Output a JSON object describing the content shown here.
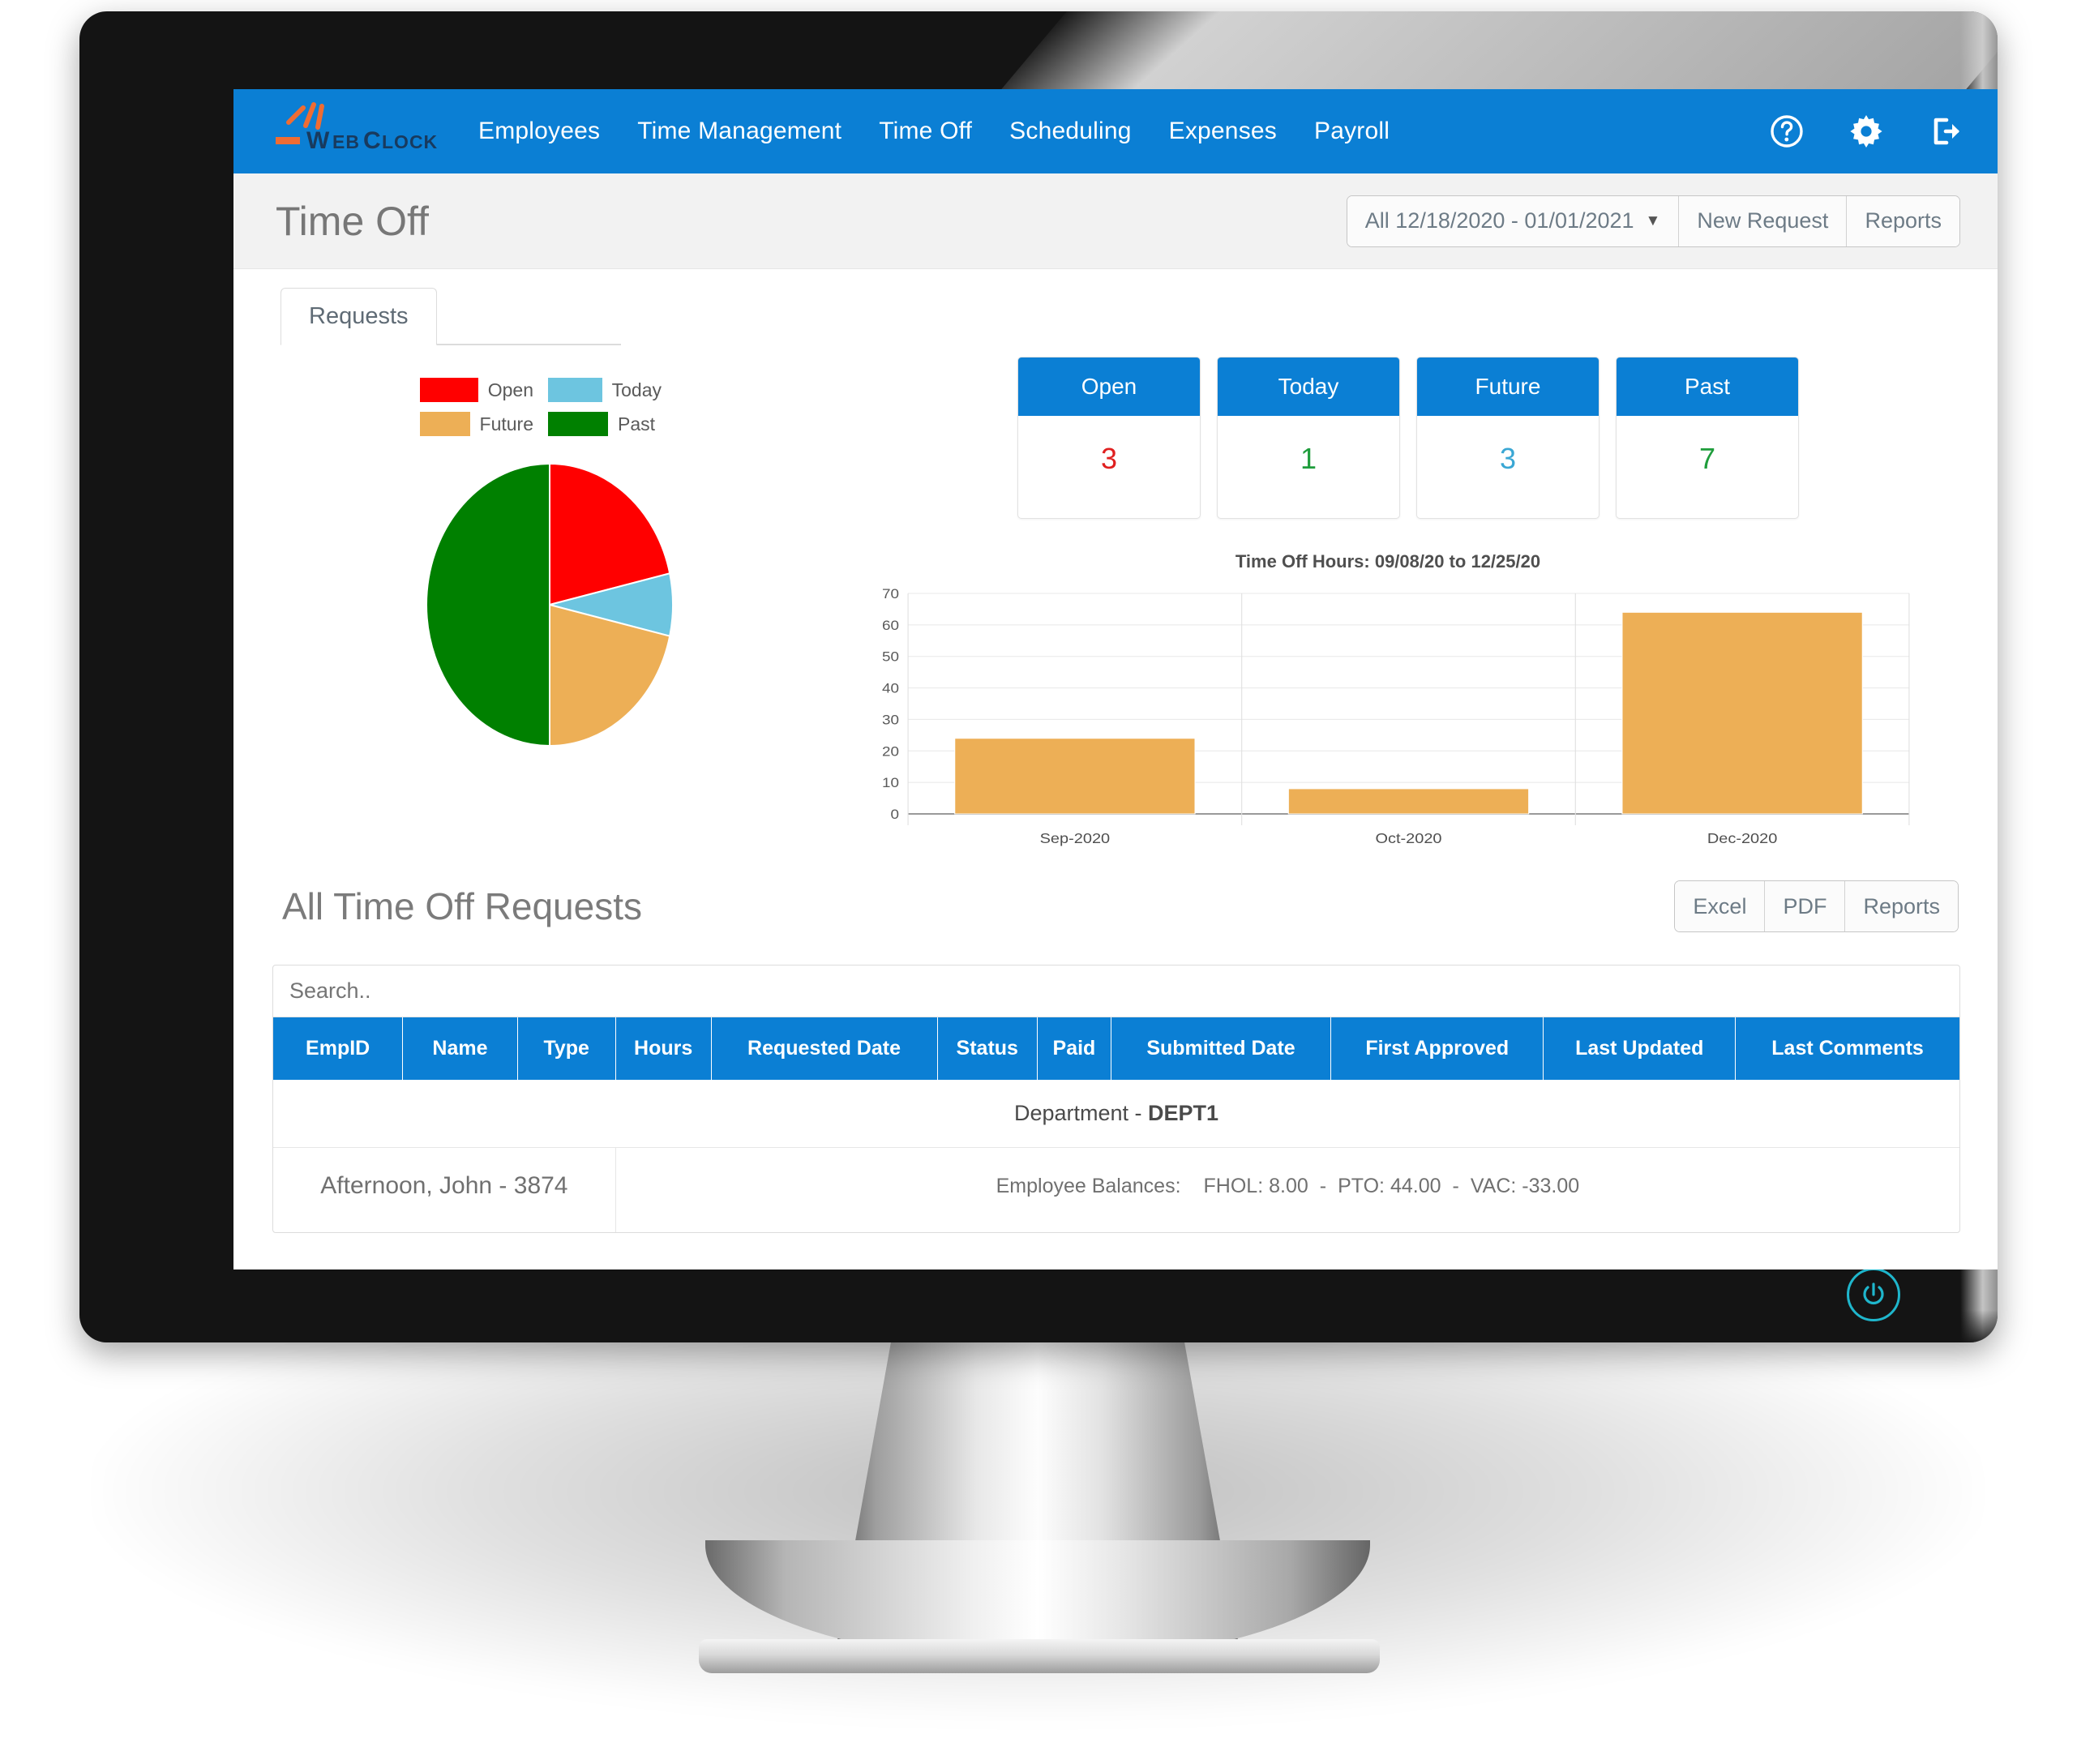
{
  "brand": {
    "name": "WebClock",
    "accent": "#0b7fd4",
    "logo_accent": "#ef6c33",
    "logo_text_color": "#183a5e"
  },
  "topnav": {
    "links": [
      {
        "label": "Employees",
        "name": "nav-employees"
      },
      {
        "label": "Time Management",
        "name": "nav-time-management"
      },
      {
        "label": "Time Off",
        "name": "nav-time-off"
      },
      {
        "label": "Scheduling",
        "name": "nav-scheduling"
      },
      {
        "label": "Expenses",
        "name": "nav-expenses"
      },
      {
        "label": "Payroll",
        "name": "nav-payroll"
      }
    ],
    "icons": [
      {
        "name": "help-icon",
        "label": "Help"
      },
      {
        "name": "gear-icon",
        "label": "Settings"
      },
      {
        "name": "logout-icon",
        "label": "Log Out"
      }
    ]
  },
  "page": {
    "title": "Time Off",
    "date_range": "All 12/18/2020 - 01/01/2021",
    "new_request_label": "New Request",
    "reports_label": "Reports"
  },
  "tabs": [
    {
      "label": "Requests",
      "active": true
    }
  ],
  "stat_cards": [
    {
      "label": "Open",
      "value": "3",
      "color": "#e02020"
    },
    {
      "label": "Today",
      "value": "1",
      "color": "#1f9d3c"
    },
    {
      "label": "Future",
      "value": "3",
      "color": "#3aa7d4"
    },
    {
      "label": "Past",
      "value": "7",
      "color": "#1f9d3c"
    }
  ],
  "chart_data": [
    {
      "type": "pie",
      "title": "",
      "legend_position": "top",
      "categories": [
        "Open",
        "Today",
        "Future",
        "Past"
      ],
      "values": [
        3,
        1,
        3,
        7
      ],
      "percentages": [
        21.4,
        7.1,
        21.4,
        50.0
      ],
      "colors": [
        "#ff0000",
        "#6dc5e0",
        "#edaf56",
        "#008000"
      ],
      "legend": [
        {
          "label": "Open",
          "color": "#ff0000"
        },
        {
          "label": "Today",
          "color": "#6dc5e0"
        },
        {
          "label": "Future",
          "color": "#edaf56"
        },
        {
          "label": "Past",
          "color": "#008000"
        }
      ]
    },
    {
      "type": "bar",
      "title": "Time Off Hours: 09/08/20 to 12/25/20",
      "categories": [
        "Sep-2020",
        "Oct-2020",
        "Dec-2020"
      ],
      "values": [
        24,
        8,
        64
      ],
      "series": [
        {
          "name": "Time Off Hours",
          "values": [
            24,
            8,
            64
          ],
          "color": "#edaf56"
        }
      ],
      "xlabel": "",
      "ylabel": "",
      "ylim": [
        0,
        70
      ],
      "yticks": [
        0,
        10,
        20,
        30,
        40,
        50,
        60,
        70
      ],
      "grid": true,
      "legend_position": "none"
    }
  ],
  "requests_section": {
    "title": "All Time Off Requests",
    "export_buttons": [
      {
        "label": "Excel",
        "name": "excel-button"
      },
      {
        "label": "PDF",
        "name": "pdf-button"
      },
      {
        "label": "Reports",
        "name": "reports-button"
      }
    ],
    "search_placeholder": "Search..",
    "search_value": "",
    "columns": [
      "EmpID",
      "Name",
      "Type",
      "Hours",
      "Requested Date",
      "Status",
      "Paid",
      "Submitted Date",
      "First Approved",
      "Last Updated",
      "Last Comments"
    ],
    "group_row": {
      "prefix": "Department - ",
      "value": "DEPT1"
    },
    "employee_row": {
      "name": "Afternoon, John - 3874",
      "balances_label": "Employee Balances:",
      "balances": [
        {
          "label": "FHOL:",
          "value": "8.00"
        },
        {
          "label": "PTO:",
          "value": "44.00"
        },
        {
          "label": "VAC:",
          "value": "-33.00"
        }
      ],
      "separator": "-"
    }
  }
}
